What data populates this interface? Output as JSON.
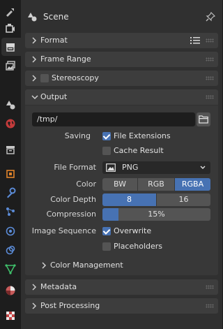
{
  "sidebar": {
    "tabs": [
      {
        "icon": "tool-icon"
      },
      {
        "icon": "render-icon"
      },
      {
        "icon": "output-icon"
      },
      {
        "icon": "view-layer-icon"
      },
      {
        "icon": "scene-icon"
      },
      {
        "icon": "world-icon"
      },
      {
        "icon": "collection-icon"
      },
      {
        "icon": "object-icon"
      },
      {
        "icon": "modifier-icon"
      },
      {
        "icon": "particles-icon"
      },
      {
        "icon": "physics-icon"
      },
      {
        "icon": "constraints-icon"
      },
      {
        "icon": "data-icon"
      },
      {
        "icon": "material-icon"
      },
      {
        "icon": "texture-icon"
      }
    ],
    "active_tab": "output-icon"
  },
  "header": {
    "title": "Scene"
  },
  "sections": {
    "format": "Format",
    "frame_range": "Frame Range",
    "stereoscopy": "Stereoscopy",
    "output": "Output",
    "metadata": "Metadata",
    "post_processing": "Post Processing"
  },
  "output": {
    "path": "/tmp/",
    "saving_label": "Saving",
    "file_extensions": {
      "label": "File Extensions",
      "checked": true
    },
    "cache_result": {
      "label": "Cache Result",
      "checked": false
    },
    "file_format_label": "File Format",
    "file_format_value": "PNG",
    "color_label": "Color",
    "color_options": [
      "BW",
      "RGB",
      "RGBA"
    ],
    "color_selected": "RGBA",
    "color_depth_label": "Color Depth",
    "color_depth_options": [
      "8",
      "16"
    ],
    "color_depth_selected": "8",
    "compression_label": "Compression",
    "compression_value": "15%",
    "compression_fraction": 0.15,
    "image_sequence_label": "Image Sequence",
    "overwrite": {
      "label": "Overwrite",
      "checked": true
    },
    "placeholders": {
      "label": "Placeholders",
      "checked": false
    },
    "color_management": "Color Management"
  },
  "colors": {
    "accent": "#4772b3",
    "panel": "#303030",
    "header": "#3d3d3d"
  }
}
